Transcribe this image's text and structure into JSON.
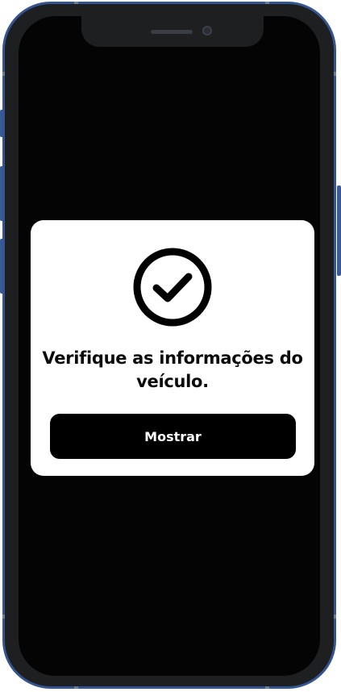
{
  "dialog": {
    "icon": "check-circle-icon",
    "message": "Verifique as informações do veículo.",
    "button_label": "Mostrar"
  },
  "colors": {
    "screen_background": "#040404",
    "card_background": "#ffffff",
    "button_background": "#000000",
    "button_text": "#ffffff",
    "frame": "#34558f"
  }
}
